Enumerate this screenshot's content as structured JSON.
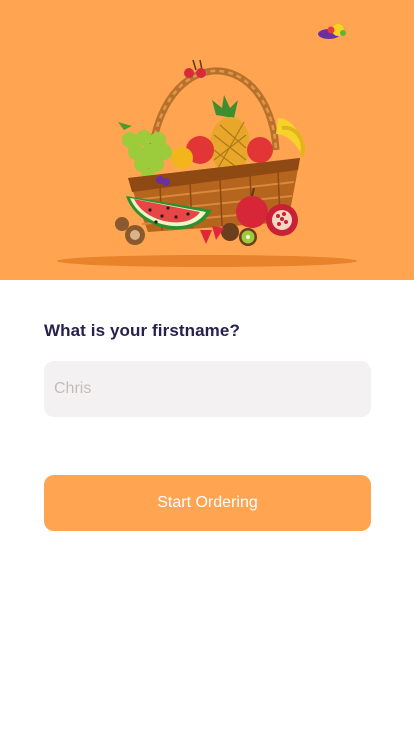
{
  "hero": {
    "background_color": "#FFA451",
    "illustration": "fruit-basket-icon",
    "top_right_icon": "fruits-icon"
  },
  "form": {
    "question": "What is your firstname?",
    "name_input": {
      "value": "",
      "placeholder": "Chris"
    },
    "submit_label": "Start Ordering"
  },
  "colors": {
    "accent": "#FFA451",
    "input_bg": "#F3F1F1",
    "text": "#27214D"
  }
}
